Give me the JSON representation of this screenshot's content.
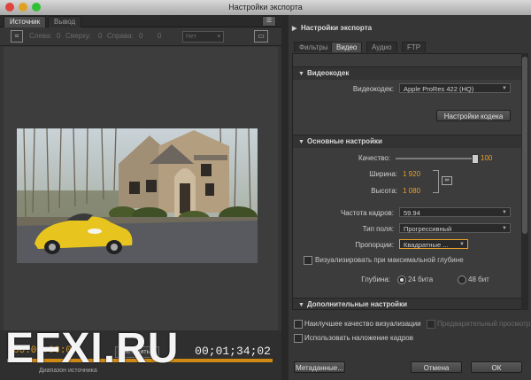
{
  "window": {
    "title": "Настройки экспорта"
  },
  "left": {
    "tabs": [
      "Источник",
      "Вывод"
    ],
    "crop": {
      "left_label": "Слева:",
      "left_val": "0",
      "top_label": "Сверху:",
      "top_val": "0",
      "right_label": "Справа:",
      "right_val": "0",
      "bottom_val": "0",
      "ratio": "Нет"
    },
    "timecode_in": "00:00:00:0",
    "timecode_out": "00;01;34;02",
    "fit_button": "Настроить",
    "range_label": "Диапазон источника"
  },
  "watermark": "EFXI.RU",
  "right": {
    "export_header": "Настройки экспорта",
    "tabs": [
      "Фильтры",
      "Видео",
      "Аудио",
      "FTP"
    ],
    "active_tab": "Видео",
    "video_codec": {
      "header": "Видеокодек",
      "codec_label": "Видеокодек:",
      "codec_value": "Apple ProRes 422 (HQ)",
      "codec_settings_button": "Настройки кодека"
    },
    "basic": {
      "header": "Основные настройки",
      "quality_label": "Качество:",
      "quality_value": 100,
      "quality_text": "100",
      "width_label": "Ширина:",
      "width_value": "1 920",
      "height_label": "Высота:",
      "height_value": "1 080",
      "framerate_label": "Частота кадров:",
      "framerate_value": "59.94",
      "field_label": "Тип поля:",
      "field_value": "Прогрессивный",
      "aspect_label": "Пропорции:",
      "aspect_value": "Квадратные ...",
      "maxdepth_label": "Визуализировать при максимальной глубине",
      "depth_label": "Глубина:",
      "depth_24": "24 бита",
      "depth_48": "48 бит"
    },
    "advanced": {
      "header": "Дополнительные настройки"
    },
    "options": {
      "max_quality": "Наилучшее качество визуализации",
      "preview": "Предварительный просмотр",
      "frame_blend": "Использовать наложение кадров"
    },
    "buttons": {
      "metadata": "Метаданные...",
      "cancel": "Отмена",
      "ok": "ОК"
    }
  },
  "colors": {
    "accent": "#e8a126",
    "panel": "#363636"
  }
}
